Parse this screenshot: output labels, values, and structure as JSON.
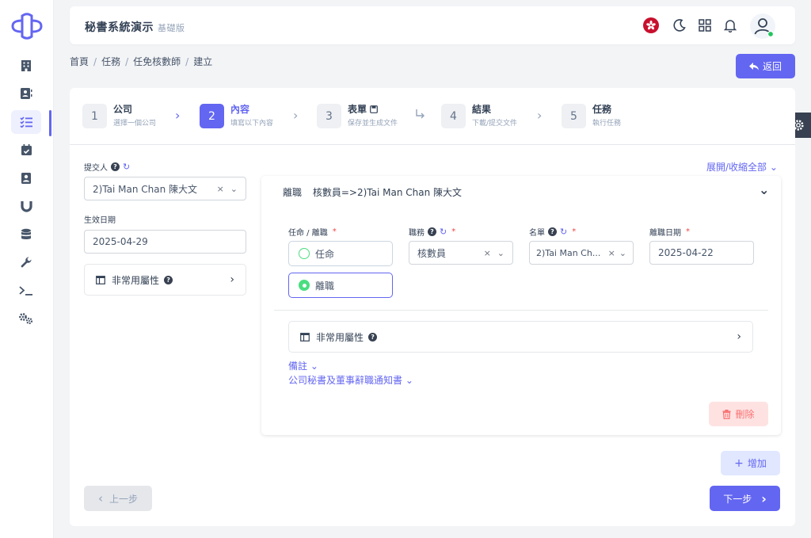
{
  "app": {
    "title": "秘書系統演示",
    "edition": "基礎版"
  },
  "sidebar": {
    "items": [
      "building-icon",
      "contacts-icon",
      "tasks-icon",
      "calendar-check-icon",
      "address-book-icon",
      "magnet-icon",
      "database-icon",
      "wrench-icon",
      "terminal-icon",
      "settings-icon"
    ],
    "active_index": 2
  },
  "topbar": {
    "icons": [
      "hk-flag-icon",
      "moon-icon",
      "grid-icon",
      "bell-icon",
      "user-avatar-icon"
    ]
  },
  "breadcrumb": [
    "首頁",
    "任務",
    "任免核數師",
    "建立"
  ],
  "back_button": "返回",
  "steps": [
    {
      "num": "1",
      "title": "公司",
      "sub": "選擇一個公司"
    },
    {
      "num": "2",
      "title": "內容",
      "sub": "填寫以下內容"
    },
    {
      "num": "3",
      "title": "表單",
      "sub": "保存並生成文件"
    },
    {
      "num": "4",
      "title": "結果",
      "sub": "下載/提交文件"
    },
    {
      "num": "5",
      "title": "任務",
      "sub": "執行任務"
    }
  ],
  "active_step": 2,
  "left": {
    "submitter_label": "提交人",
    "submitter_value": "2)Tai Man Chan 陳大文",
    "effective_date_label": "生效日期",
    "effective_date_value": "2025-04-29",
    "uncommon_props": "非常用屬性"
  },
  "expand_all": "展開/收縮全部",
  "entry": {
    "header_type": "離職",
    "header_detail": "核數員=>2)Tai Man Chan 陳大文",
    "action_label": "任命 / 離職",
    "action_options": [
      "任命",
      "離職"
    ],
    "selected_action": "離職",
    "position_label": "職務",
    "position_value": "核數員",
    "name_label": "名單",
    "name_value": "2)Tai Man Ch...",
    "resign_date_label": "離職日期",
    "resign_date_value": "2025-04-22",
    "uncommon_props": "非常用屬性",
    "remarks_link": "備註",
    "notice_link": "公司秘書及董事辭職通知書",
    "delete_button": "刪除"
  },
  "add_button": "增加",
  "prev_button": "上一步",
  "next_button": "下一步",
  "colors": {
    "accent": "#6366f1",
    "danger_bg": "#fee2e2",
    "danger_text": "#f87171",
    "success": "#4ade80"
  }
}
